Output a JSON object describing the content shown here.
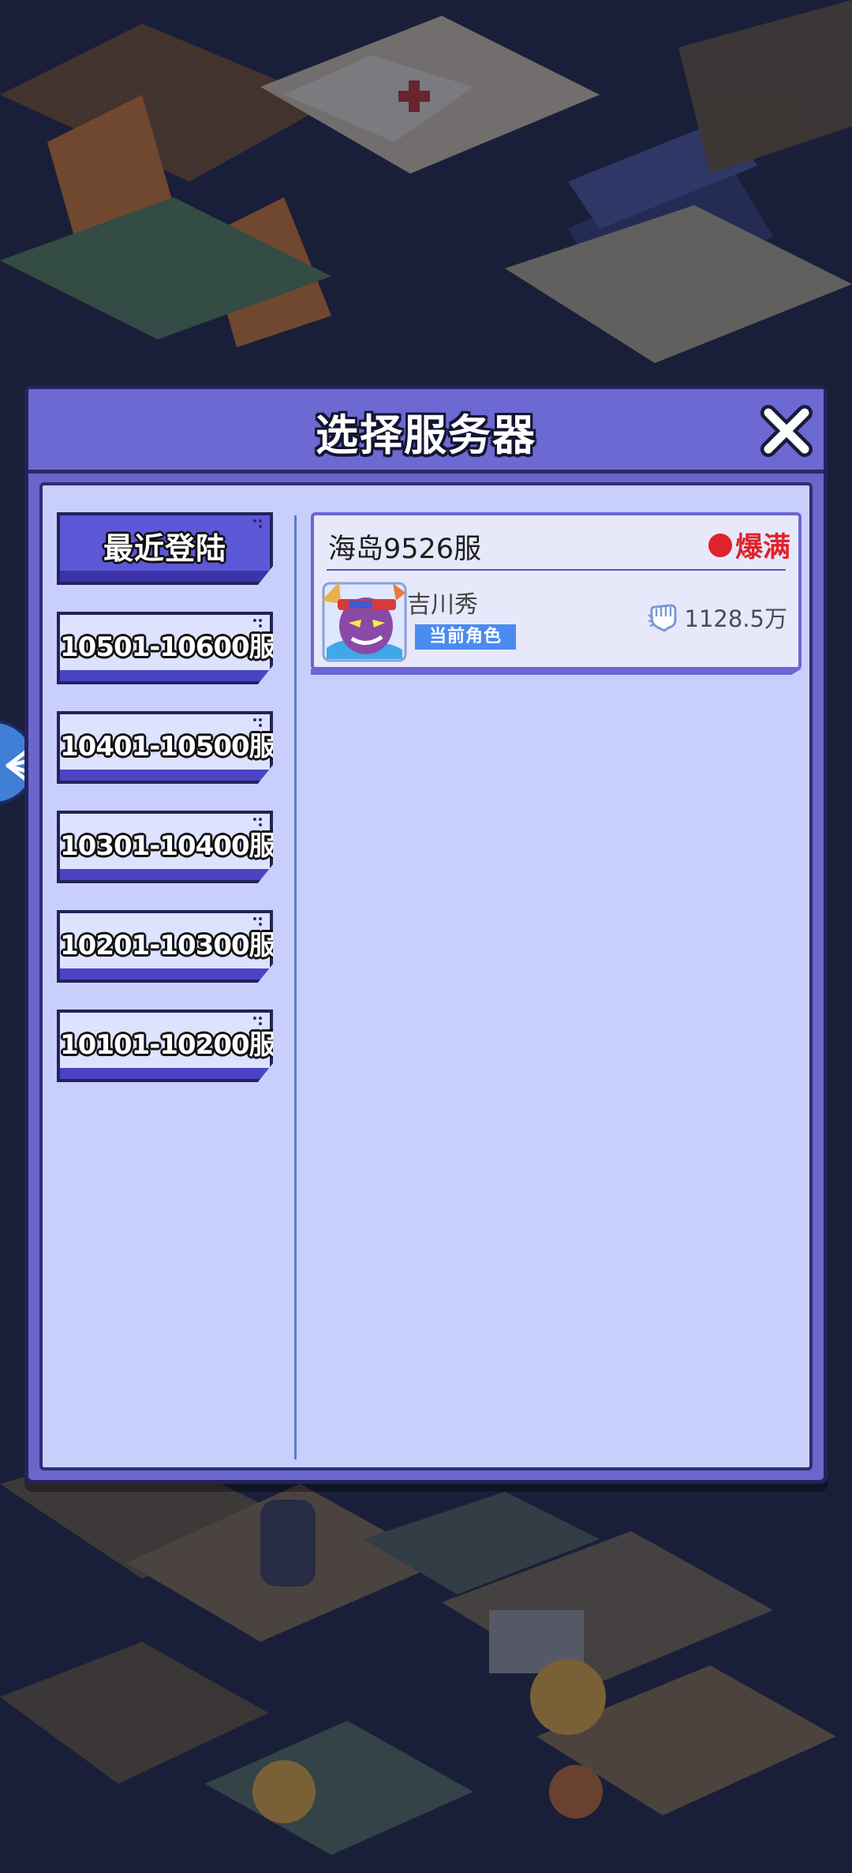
{
  "dialog": {
    "title": "选择服务器"
  },
  "sidebar": {
    "tabs": [
      {
        "label": "最近登陆",
        "active": true
      },
      {
        "label": "10501-10600服",
        "active": false
      },
      {
        "label": "10401-10500服",
        "active": false
      },
      {
        "label": "10301-10400服",
        "active": false
      },
      {
        "label": "10201-10300服",
        "active": false
      },
      {
        "label": "10101-10200服",
        "active": false
      }
    ]
  },
  "servers": [
    {
      "name": "海岛9526服",
      "status": "爆满",
      "status_color": "#e0222a",
      "character_name": "吉川秀",
      "role_badge": "当前角色",
      "power": "1128.5万",
      "power_icon": "fist-icon"
    }
  ],
  "colors": {
    "accent": "#6a66cc",
    "panel_bg": "#c8cffc",
    "badge": "#4b8bf0"
  }
}
